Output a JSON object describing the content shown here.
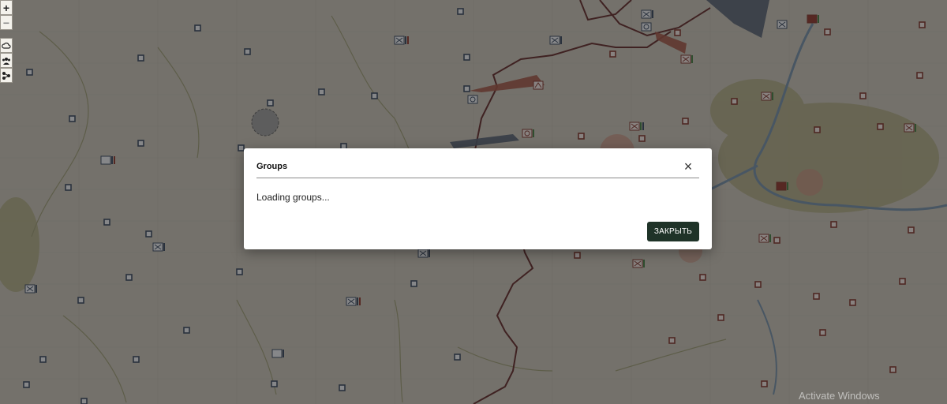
{
  "map": {
    "colors": {
      "terrain": "#c9c3b6",
      "river": "#6e8aa6",
      "front_line": "#5a1e1e",
      "friendly": "#2d3e56",
      "enemy": "#7a2a20",
      "vegetation": "#8d8c5c"
    }
  },
  "map_controls": {
    "zoom_in": "+",
    "zoom_out": "−",
    "icons": [
      "weather-icon",
      "units-icon",
      "layers-icon"
    ]
  },
  "dialog": {
    "title": "Groups",
    "message": "Loading groups...",
    "close_button": "ЗАКРЫТЬ",
    "close_icon": "×"
  },
  "watermark": "Activate Windows"
}
